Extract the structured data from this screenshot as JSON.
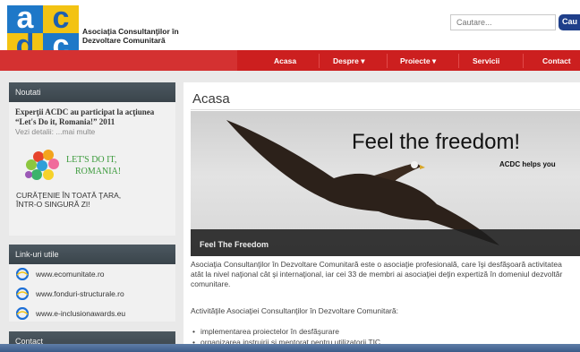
{
  "header": {
    "logo_letters": [
      "a",
      "c",
      "d",
      "c"
    ],
    "brand_line1": "Asociaţia Consultanţilor în",
    "brand_line2": "Dezvoltare Comunitară",
    "search_placeholder": "Cautare...",
    "search_button": "Cau"
  },
  "nav": {
    "items": [
      "Acasa",
      "Despre",
      "Proiecte",
      "Servicii",
      "Contact"
    ],
    "dropdown_marker": "▾"
  },
  "sidebar": {
    "news": {
      "heading": "Noutati",
      "line1": "Experţii ACDC au participat la acţiunea",
      "line2": "“Let's Do it, Romania!” 2011",
      "line3": "Vezi detalii: ...mai multe",
      "campaign_line1": "LET'S DO IT,",
      "campaign_line2": "ROMANIA!",
      "campaign_line3": "CURĂŢENIE ÎN TOATĂ ŢARA,",
      "campaign_line4": "ÎNTR-O SINGURĂ ZI!"
    },
    "links": {
      "heading": "Link-uri utile",
      "items": [
        "www.ecomunitate.ro",
        "www.fonduri-structurale.ro",
        "www.e-inclusionawards.eu"
      ]
    },
    "contact": {
      "heading": "Contact"
    }
  },
  "main": {
    "title": "Acasa",
    "banner_title": "Feel the freedom!",
    "banner_sub": "ACDC helps you",
    "banner_caption": "Feel The Freedom",
    "para1_line1": "Asociaţia Consultanţilor în Dezvoltare Comunitară este o asociaţie profesională, care îşi desfăşoară activitatea",
    "para1_line2": "atât la nivel naţional cât şi internaţional, iar cei 33 de membri ai asociaţiei deţin expertiză în domeniul dezvoltăr",
    "para1_line3": "comunitare.",
    "para2": "Activităţile Asociaţiei Consultanţilor în Dezvoltare Comunitară:",
    "bullets": [
      "implementarea proiectelor în desfăşurare",
      "organizarea instruirii şi mentorat pentru utilizatorii TIC"
    ]
  },
  "colors": {
    "nav_red": "#cc1f1f",
    "logo_blue": "#1e78c8",
    "logo_yellow": "#f3c313",
    "panel_head": "#3f4a51"
  }
}
